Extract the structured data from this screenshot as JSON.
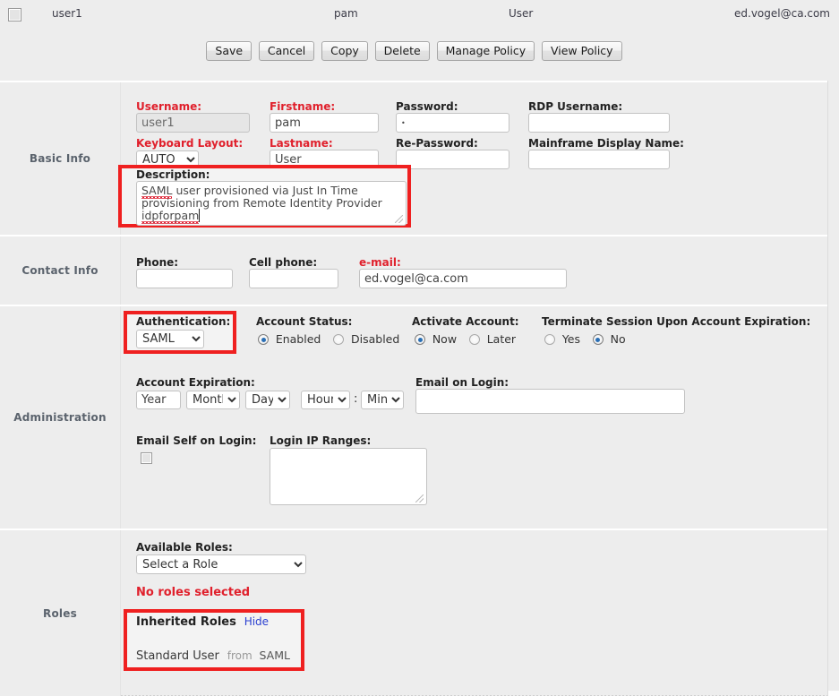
{
  "summary_row": {
    "username": "user1",
    "firstname": "pam",
    "lastname": "User",
    "email": "ed.vogel@ca.com"
  },
  "toolbar": {
    "save": "Save",
    "cancel": "Cancel",
    "copy": "Copy",
    "delete": "Delete",
    "manage_policy": "Manage Policy",
    "view_policy": "View Policy"
  },
  "sections": {
    "basic_info": "Basic Info",
    "contact_info": "Contact Info",
    "administration": "Administration",
    "roles": "Roles"
  },
  "basic_info": {
    "username_label": "Username:",
    "username_value": "user1",
    "keyboard_label": "Keyboard Layout:",
    "keyboard_value": "AUTO",
    "firstname_label": "Firstname:",
    "firstname_value": "pam",
    "lastname_label": "Lastname:",
    "lastname_value": "User",
    "password_label": "Password:",
    "password_value": "●",
    "repassword_label": "Re-Password:",
    "repassword_value": "",
    "rdp_username_label": "RDP Username:",
    "rdp_username_value": "",
    "mainframe_label": "Mainframe Display Name:",
    "mainframe_value": "",
    "description_label": "Description:",
    "description_line1_a": "SAML",
    "description_line1_b": " user provisioned via Just In Time",
    "description_line2": "provisioning from Remote Identity Provider",
    "description_line3": "idpforpam"
  },
  "contact_info": {
    "phone_label": "Phone:",
    "phone_value": "",
    "cell_label": "Cell phone:",
    "cell_value": "",
    "email_label": "e-mail:",
    "email_value": "ed.vogel@ca.com"
  },
  "administration": {
    "auth_label": "Authentication:",
    "auth_value": "SAML",
    "account_status_label": "Account Status:",
    "status_enabled": "Enabled",
    "status_disabled": "Disabled",
    "status_selected": "Enabled",
    "activate_label": "Activate Account:",
    "activate_now": "Now",
    "activate_later": "Later",
    "activate_selected": "Now",
    "terminate_label": "Terminate Session Upon Account Expiration:",
    "terminate_yes": "Yes",
    "terminate_no": "No",
    "terminate_selected": "No",
    "expiration_label": "Account Expiration:",
    "exp_year": "Year",
    "exp_month": "Month",
    "exp_day": "Day",
    "exp_hour": "Hour",
    "exp_colon": ":",
    "exp_min": "Min",
    "email_on_login_label": "Email on Login:",
    "email_on_login_value": "",
    "email_self_label": "Email Self on Login:",
    "login_ip_label": "Login IP Ranges:",
    "login_ip_value": ""
  },
  "roles": {
    "available_label": "Available Roles:",
    "available_value": "Select a Role",
    "no_roles": "No roles selected",
    "inherited_title": "Inherited Roles",
    "hide_link": "Hide",
    "inherited_role_name": "Standard User",
    "inherited_from": "from",
    "inherited_source": "SAML"
  },
  "colors": {
    "required_red": "#e0202c",
    "highlight_red": "#ef2020",
    "link_blue": "#2a3fd0",
    "radio_blue": "#2a6fb5",
    "section_label": "#5b636d",
    "page_bg": "#ededed"
  }
}
